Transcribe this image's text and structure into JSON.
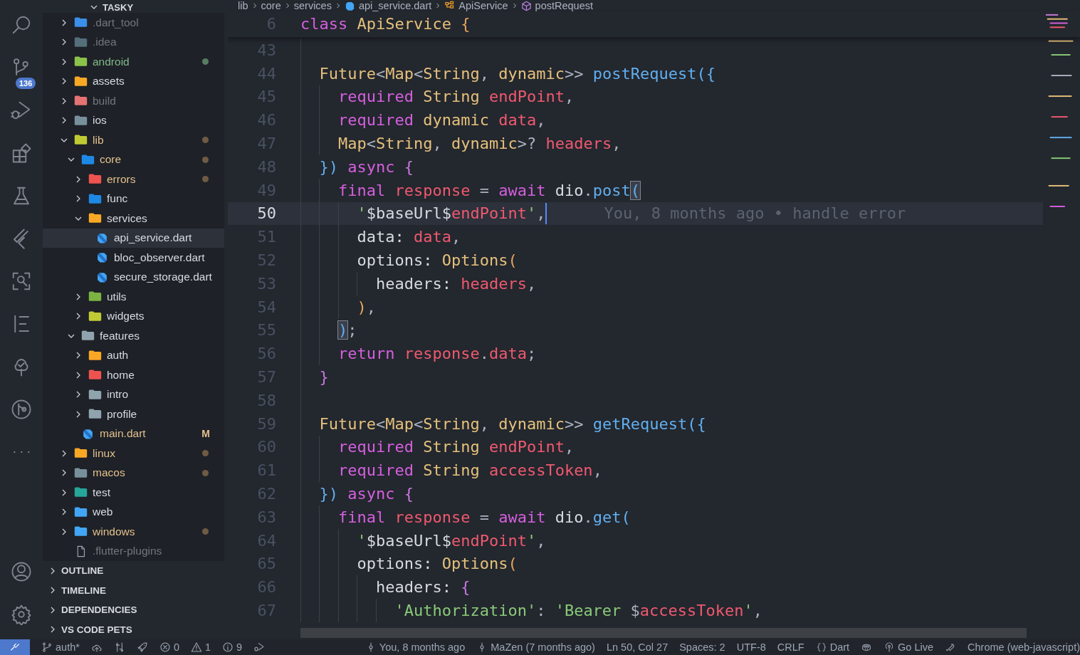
{
  "activity_bar": {
    "top": [
      {
        "kind": "search"
      },
      {
        "kind": "source-control",
        "badge": "136"
      },
      {
        "kind": "run-debug"
      },
      {
        "kind": "extensions"
      },
      {
        "kind": "flask"
      },
      {
        "kind": "flutter"
      },
      {
        "kind": "scan"
      },
      {
        "kind": "outline"
      },
      {
        "kind": "tree"
      },
      {
        "kind": "git-graph"
      },
      {
        "kind": "more"
      }
    ],
    "bottom": [
      {
        "kind": "account"
      },
      {
        "kind": "settings"
      }
    ]
  },
  "explorer": {
    "title": "TASKY",
    "tree": [
      {
        "name": ".dart_tool",
        "kind": "folder",
        "ignored": true,
        "modified": false,
        "untracked": false,
        "expanded": false,
        "selected": false,
        "color": "#3b8eea"
      },
      {
        "name": ".idea",
        "kind": "folder",
        "ignored": true,
        "modified": false,
        "untracked": false,
        "expanded": false,
        "selected": false,
        "color": "#546e7a"
      },
      {
        "name": "android",
        "kind": "folder",
        "ignored": false,
        "modified": false,
        "untracked": true,
        "expanded": false,
        "selected": false,
        "color": "#8bc34a"
      },
      {
        "name": "assets",
        "kind": "folder",
        "ignored": false,
        "modified": false,
        "untracked": false,
        "expanded": false,
        "selected": false,
        "color": "#f9a825"
      },
      {
        "name": "build",
        "kind": "folder",
        "ignored": true,
        "modified": false,
        "untracked": false,
        "expanded": false,
        "selected": false,
        "color": "#e57373"
      },
      {
        "name": "ios",
        "kind": "folder",
        "ignored": false,
        "modified": false,
        "untracked": false,
        "expanded": false,
        "selected": false,
        "color": "#78909c"
      },
      {
        "name": "lib",
        "kind": "folder",
        "ignored": false,
        "modified": true,
        "untracked": false,
        "expanded": true,
        "selected": false,
        "color": "#c0ca33",
        "children": [
          {
            "name": "core",
            "kind": "folder",
            "ignored": false,
            "modified": true,
            "untracked": false,
            "expanded": true,
            "selected": false,
            "color": "#1e88e5",
            "children": [
              {
                "name": "errors",
                "kind": "folder",
                "ignored": false,
                "modified": true,
                "untracked": false,
                "expanded": false,
                "selected": false,
                "color": "#ef5350"
              },
              {
                "name": "func",
                "kind": "folder",
                "ignored": false,
                "modified": false,
                "untracked": false,
                "expanded": false,
                "selected": false,
                "color": "#1e88e5"
              },
              {
                "name": "services",
                "kind": "folder",
                "ignored": false,
                "modified": false,
                "untracked": false,
                "expanded": true,
                "selected": false,
                "color": "#f9a825",
                "children": [
                  {
                    "name": "api_service.dart",
                    "kind": "dart",
                    "ignored": false,
                    "modified": false,
                    "untracked": false,
                    "selected": true
                  },
                  {
                    "name": "bloc_observer.dart",
                    "kind": "dart",
                    "ignored": false,
                    "modified": false,
                    "untracked": false,
                    "selected": false
                  },
                  {
                    "name": "secure_storage.dart",
                    "kind": "dart",
                    "ignored": false,
                    "modified": false,
                    "untracked": false,
                    "selected": false
                  }
                ]
              },
              {
                "name": "utils",
                "kind": "folder",
                "ignored": false,
                "modified": false,
                "untracked": false,
                "expanded": false,
                "selected": false,
                "color": "#7cb342"
              },
              {
                "name": "widgets",
                "kind": "folder",
                "ignored": false,
                "modified": false,
                "untracked": false,
                "expanded": false,
                "selected": false,
                "color": "#c0ca33"
              }
            ]
          },
          {
            "name": "features",
            "kind": "folder",
            "ignored": false,
            "modified": false,
            "untracked": false,
            "expanded": true,
            "selected": false,
            "color": "#90a4ae",
            "children": [
              {
                "name": "auth",
                "kind": "folder",
                "ignored": false,
                "modified": false,
                "untracked": false,
                "expanded": false,
                "selected": false,
                "color": "#f9a825"
              },
              {
                "name": "home",
                "kind": "folder",
                "ignored": false,
                "modified": false,
                "untracked": false,
                "expanded": false,
                "selected": false,
                "color": "#ef5350"
              },
              {
                "name": "intro",
                "kind": "folder",
                "ignored": false,
                "modified": false,
                "untracked": false,
                "expanded": false,
                "selected": false,
                "color": "#90a4ae"
              },
              {
                "name": "profile",
                "kind": "folder",
                "ignored": false,
                "modified": false,
                "untracked": false,
                "expanded": false,
                "selected": false,
                "color": "#90a4ae"
              }
            ]
          },
          {
            "name": "main.dart",
            "kind": "dart",
            "ignored": false,
            "modified": true,
            "untracked": false,
            "badge": "M",
            "selected": false
          }
        ]
      },
      {
        "name": "linux",
        "kind": "folder",
        "ignored": false,
        "modified": true,
        "untracked": false,
        "expanded": false,
        "selected": false,
        "color": "#f9a825"
      },
      {
        "name": "macos",
        "kind": "folder",
        "ignored": false,
        "modified": true,
        "untracked": false,
        "expanded": false,
        "selected": false,
        "color": "#78909c"
      },
      {
        "name": "test",
        "kind": "folder",
        "ignored": false,
        "modified": false,
        "untracked": false,
        "expanded": false,
        "selected": false,
        "color": "#26a69a"
      },
      {
        "name": "web",
        "kind": "folder",
        "ignored": false,
        "modified": false,
        "untracked": false,
        "expanded": false,
        "selected": false,
        "color": "#42a5f5"
      },
      {
        "name": "windows",
        "kind": "folder",
        "ignored": false,
        "modified": true,
        "untracked": false,
        "expanded": false,
        "selected": false,
        "color": "#42a5f5"
      },
      {
        "name": ".flutter-plugins",
        "kind": "file",
        "ignored": true,
        "modified": false,
        "untracked": false,
        "selected": false
      }
    ]
  },
  "panels": [
    {
      "title": "OUTLINE",
      "expanded": false
    },
    {
      "title": "TIMELINE",
      "expanded": false
    },
    {
      "title": "DEPENDENCIES",
      "expanded": false
    },
    {
      "title": "VS CODE PETS",
      "expanded": false
    }
  ],
  "breadcrumb": [
    {
      "text": "lib"
    },
    {
      "text": "core"
    },
    {
      "text": "services"
    },
    {
      "text": "api_service.dart",
      "kind": "dart"
    },
    {
      "text": "ApiService",
      "kind": "class"
    },
    {
      "text": "postRequest",
      "kind": "method"
    }
  ],
  "sticky_line": {
    "number": "6",
    "tokens": [
      {
        "text": "class ",
        "kind": "kw"
      },
      {
        "text": "ApiService ",
        "kind": "type"
      },
      {
        "text": "{",
        "kind": "b1"
      }
    ]
  },
  "code_lines": [
    {
      "number": "43"
    },
    {
      "number": "44",
      "tokens": [
        {
          "text": "  Future",
          "kind": "type"
        },
        {
          "text": "<",
          "kind": "p"
        },
        {
          "text": "Map",
          "kind": "type"
        },
        {
          "text": "<",
          "kind": "p"
        },
        {
          "text": "String",
          "kind": "type"
        },
        {
          "text": ", ",
          "kind": "p"
        },
        {
          "text": "dynamic",
          "kind": "type"
        },
        {
          "text": ">> ",
          "kind": "p"
        },
        {
          "text": "postRequest",
          "kind": "fn"
        },
        {
          "text": "({",
          "kind": "b3"
        }
      ]
    },
    {
      "number": "45",
      "tokens": [
        {
          "text": "    required ",
          "kind": "kw"
        },
        {
          "text": "String ",
          "kind": "type"
        },
        {
          "text": "endPoint",
          "kind": "var"
        },
        {
          "text": ",",
          "kind": "p"
        }
      ]
    },
    {
      "number": "46",
      "tokens": [
        {
          "text": "    required ",
          "kind": "kw"
        },
        {
          "text": "dynamic ",
          "kind": "type"
        },
        {
          "text": "data",
          "kind": "var"
        },
        {
          "text": ",",
          "kind": "p"
        }
      ]
    },
    {
      "number": "47",
      "tokens": [
        {
          "text": "    Map",
          "kind": "type"
        },
        {
          "text": "<",
          "kind": "p"
        },
        {
          "text": "String",
          "kind": "type"
        },
        {
          "text": ", ",
          "kind": "p"
        },
        {
          "text": "dynamic",
          "kind": "type"
        },
        {
          "text": ">? ",
          "kind": "p"
        },
        {
          "text": "headers",
          "kind": "var"
        },
        {
          "text": ",",
          "kind": "p"
        }
      ]
    },
    {
      "number": "48",
      "tokens": [
        {
          "text": "  })",
          "kind": "b3"
        },
        {
          "text": " async ",
          "kind": "kw"
        },
        {
          "text": "{",
          "kind": "b2"
        }
      ]
    },
    {
      "number": "49",
      "tokens": [
        {
          "text": "    final ",
          "kind": "kw"
        },
        {
          "text": "response",
          "kind": "var"
        },
        {
          "text": " = ",
          "kind": "p"
        },
        {
          "text": "await ",
          "kind": "kw"
        },
        {
          "text": "dio",
          "kind": "plain"
        },
        {
          "text": ".",
          "kind": "p"
        },
        {
          "text": "post",
          "kind": "fn"
        },
        {
          "text": "(",
          "kind": "b3",
          "matched": true
        }
      ]
    },
    {
      "number": "50",
      "current": true,
      "blame": "You, 8 months ago • handle error",
      "tokens": [
        {
          "text": "      '",
          "kind": "str"
        },
        {
          "text": "$baseUrl$",
          "kind": "plain"
        },
        {
          "text": "endPoint",
          "kind": "var"
        },
        {
          "text": "'",
          "kind": "str"
        },
        {
          "text": ",",
          "kind": "p"
        }
      ]
    },
    {
      "number": "51",
      "tokens": [
        {
          "text": "      data: ",
          "kind": "plain"
        },
        {
          "text": "data",
          "kind": "var"
        },
        {
          "text": ",",
          "kind": "p"
        }
      ]
    },
    {
      "number": "52",
      "tokens": [
        {
          "text": "      options: ",
          "kind": "plain"
        },
        {
          "text": "Options",
          "kind": "type"
        },
        {
          "text": "(",
          "kind": "b1"
        }
      ]
    },
    {
      "number": "53",
      "tokens": [
        {
          "text": "        headers: ",
          "kind": "plain"
        },
        {
          "text": "headers",
          "kind": "var"
        },
        {
          "text": ",",
          "kind": "p"
        }
      ]
    },
    {
      "number": "54",
      "tokens": [
        {
          "text": "      )",
          "kind": "b1"
        },
        {
          "text": ",",
          "kind": "p"
        }
      ]
    },
    {
      "number": "55",
      "tokens": [
        {
          "text": "    )",
          "kind": "b3",
          "matched": true
        },
        {
          "text": ";",
          "kind": "p"
        }
      ]
    },
    {
      "number": "56",
      "tokens": [
        {
          "text": "    return ",
          "kind": "kw"
        },
        {
          "text": "response",
          "kind": "var"
        },
        {
          "text": ".",
          "kind": "p"
        },
        {
          "text": "data",
          "kind": "var"
        },
        {
          "text": ";",
          "kind": "p"
        }
      ]
    },
    {
      "number": "57",
      "tokens": [
        {
          "text": "  }",
          "kind": "b2"
        }
      ]
    },
    {
      "number": "58"
    },
    {
      "number": "59",
      "tokens": [
        {
          "text": "  Future",
          "kind": "type"
        },
        {
          "text": "<",
          "kind": "p"
        },
        {
          "text": "Map",
          "kind": "type"
        },
        {
          "text": "<",
          "kind": "p"
        },
        {
          "text": "String",
          "kind": "type"
        },
        {
          "text": ", ",
          "kind": "p"
        },
        {
          "text": "dynamic",
          "kind": "type"
        },
        {
          "text": ">> ",
          "kind": "p"
        },
        {
          "text": "getRequest",
          "kind": "fn"
        },
        {
          "text": "({",
          "kind": "b3"
        }
      ]
    },
    {
      "number": "60",
      "tokens": [
        {
          "text": "    required ",
          "kind": "kw"
        },
        {
          "text": "String ",
          "kind": "type"
        },
        {
          "text": "endPoint",
          "kind": "var"
        },
        {
          "text": ",",
          "kind": "p"
        }
      ]
    },
    {
      "number": "61",
      "tokens": [
        {
          "text": "    required ",
          "kind": "kw"
        },
        {
          "text": "String ",
          "kind": "type"
        },
        {
          "text": "accessToken",
          "kind": "var"
        },
        {
          "text": ",",
          "kind": "p"
        }
      ]
    },
    {
      "number": "62",
      "tokens": [
        {
          "text": "  })",
          "kind": "b3"
        },
        {
          "text": " async ",
          "kind": "kw"
        },
        {
          "text": "{",
          "kind": "b2"
        }
      ]
    },
    {
      "number": "63",
      "tokens": [
        {
          "text": "    final ",
          "kind": "kw"
        },
        {
          "text": "response",
          "kind": "var"
        },
        {
          "text": " = ",
          "kind": "p"
        },
        {
          "text": "await ",
          "kind": "kw"
        },
        {
          "text": "dio",
          "kind": "plain"
        },
        {
          "text": ".",
          "kind": "p"
        },
        {
          "text": "get",
          "kind": "fn"
        },
        {
          "text": "(",
          "kind": "b3"
        }
      ]
    },
    {
      "number": "64",
      "tokens": [
        {
          "text": "      '",
          "kind": "str"
        },
        {
          "text": "$baseUrl$",
          "kind": "plain"
        },
        {
          "text": "endPoint",
          "kind": "var"
        },
        {
          "text": "'",
          "kind": "str"
        },
        {
          "text": ",",
          "kind": "p"
        }
      ]
    },
    {
      "number": "65",
      "tokens": [
        {
          "text": "      options: ",
          "kind": "plain"
        },
        {
          "text": "Options",
          "kind": "type"
        },
        {
          "text": "(",
          "kind": "b1"
        }
      ]
    },
    {
      "number": "66",
      "tokens": [
        {
          "text": "        headers: ",
          "kind": "plain"
        },
        {
          "text": "{",
          "kind": "b2"
        }
      ]
    },
    {
      "number": "67",
      "tokens": [
        {
          "text": "          'Authorization'",
          "kind": "str"
        },
        {
          "text": ": ",
          "kind": "p"
        },
        {
          "text": "'Bearer ",
          "kind": "str"
        },
        {
          "text": "$",
          "kind": "p"
        },
        {
          "text": "accessToken",
          "kind": "var"
        },
        {
          "text": "'",
          "kind": "str"
        },
        {
          "text": ",",
          "kind": "p"
        }
      ]
    }
  ],
  "status_bar": {
    "left": [
      {
        "kind": "remote"
      },
      {
        "kind": "branch",
        "text": "auth*"
      },
      {
        "kind": "cloud-upload"
      },
      {
        "kind": "git-compare"
      },
      {
        "kind": "rocket"
      },
      {
        "kind": "error",
        "text": "0"
      },
      {
        "kind": "warning",
        "text": "1"
      },
      {
        "kind": "info",
        "text": "9"
      },
      {
        "kind": "debug"
      }
    ],
    "right": [
      {
        "kind": "commit",
        "text": "You, 8 months ago"
      },
      {
        "kind": "commit",
        "text": "MaZen (7 months ago)"
      },
      {
        "kind": "text",
        "text": "Ln 50, Col 27"
      },
      {
        "kind": "text",
        "text": "Spaces: 2"
      },
      {
        "kind": "text",
        "text": "UTF-8"
      },
      {
        "kind": "text",
        "text": "CRLF"
      },
      {
        "kind": "braces",
        "text": "Dart"
      },
      {
        "kind": "copilot"
      },
      {
        "kind": "broadcast",
        "text": "Go Live"
      },
      {
        "kind": "tool"
      },
      {
        "kind": "text",
        "text": "Chrome (web-javascript)"
      }
    ]
  }
}
